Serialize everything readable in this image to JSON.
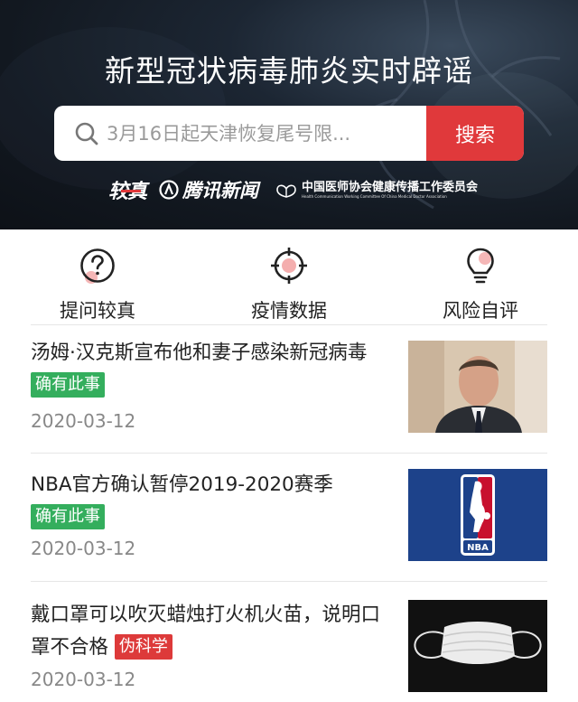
{
  "header": {
    "title": "新型冠状病毒肺炎实时辟谣",
    "search_placeholder": "3月16日起天津恢复尾号限...",
    "search_button": "搜索",
    "partners": {
      "jiaozhen": "较真",
      "tencent": "腾讯新闻",
      "cma_cn": "中国医师协会健康传播工作委员会",
      "cma_en": "Health Communication Working Committee Of China Medical Doctor Association"
    }
  },
  "nav": [
    {
      "label": "提问较真",
      "icon": "question-circle-icon"
    },
    {
      "label": "疫情数据",
      "icon": "target-crosshair-icon"
    },
    {
      "label": "风险自评",
      "icon": "lightbulb-icon"
    }
  ],
  "news": [
    {
      "title": "汤姆·汉克斯宣布他和妻子感染新冠病毒",
      "tag": "确有此事",
      "tag_type": "true",
      "date": "2020-03-12",
      "image": "tom-hanks-photo"
    },
    {
      "title": "NBA官方确认暂停2019-2020赛季",
      "tag": "确有此事",
      "tag_type": "true",
      "date": "2020-03-12",
      "image": "nba-logo",
      "image_text": "NBA"
    },
    {
      "title": "戴口罩可以吹灭蜡烛打火机火苗，说明口罩不合格",
      "tag": "伪科学",
      "tag_type": "false",
      "date": "2020-03-12",
      "image": "face-mask-photo"
    }
  ],
  "colors": {
    "accent_red": "#e0393b",
    "tag_green": "#34ae5d",
    "tag_red": "#dd3a3a",
    "nba_blue": "#1d428a",
    "nba_red": "#c8102e"
  }
}
